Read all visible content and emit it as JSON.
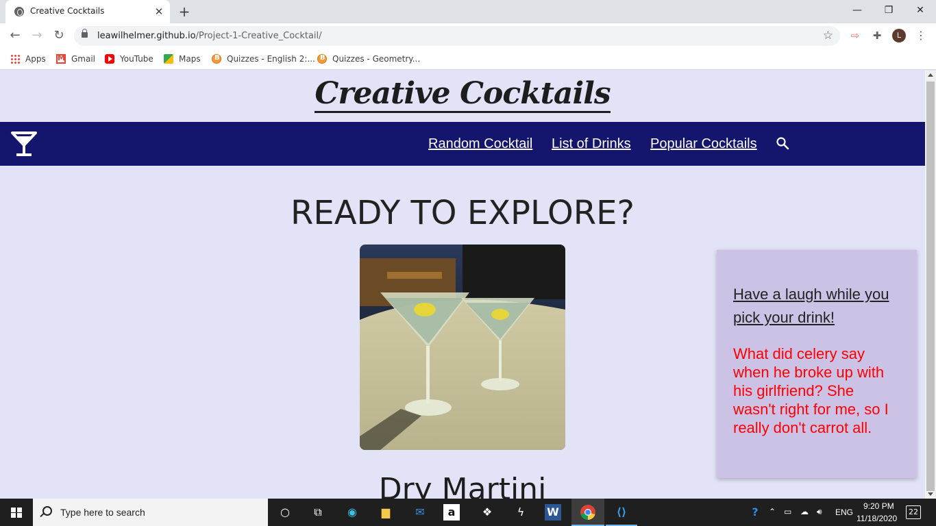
{
  "browser": {
    "tab_title": "Creative Cocktails",
    "tab_close": "✕",
    "new_tab": "+",
    "url_host": "leawilhelmer.github.io",
    "url_path": "/Project-1-Creative_Cocktail/",
    "profile_initial": "L",
    "window_controls": {
      "minimize": "—",
      "maximize": "❐",
      "close": "✕"
    }
  },
  "bookmarks": [
    {
      "label": "Apps",
      "icon": "apps-grid-icon"
    },
    {
      "label": "Gmail",
      "icon": "gmail-icon"
    },
    {
      "label": "YouTube",
      "icon": "youtube-icon"
    },
    {
      "label": "Maps",
      "icon": "maps-icon"
    },
    {
      "label": "Quizzes - English 2:...",
      "icon": "quizzes-icon"
    },
    {
      "label": "Quizzes - Geometry...",
      "icon": "quizzes-icon"
    }
  ],
  "site": {
    "title": "Creative Cocktails",
    "nav": {
      "random": "Random Cocktail",
      "list": "List of Drinks",
      "popular": "Popular Cocktails"
    },
    "heading": "READY TO EXPLORE?",
    "drink_name": "Dry Martini",
    "joke_heading": "Have a laugh while you pick your drink!",
    "joke_text": "What did celery say when he broke up with his girlfriend? She wasn't right for me, so I really don't carrot all."
  },
  "taskbar": {
    "search_placeholder": "Type here to search",
    "language": "ENG",
    "time": "9:20 PM",
    "date": "11/18/2020",
    "notifications": "22"
  },
  "colors": {
    "page_bg": "#e3e3f8",
    "navbar_bg": "#14166d",
    "joke_card_bg": "#cbc2e6",
    "joke_text": "#ff0000"
  }
}
